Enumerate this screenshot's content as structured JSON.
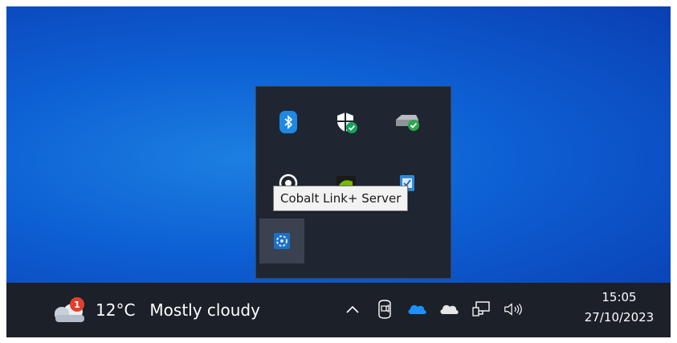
{
  "tray_overflow": {
    "icons": [
      {
        "name": "bluetooth-icon"
      },
      {
        "name": "windows-security-icon"
      },
      {
        "name": "safely-remove-hardware-icon"
      },
      {
        "name": "app-tray-icon"
      },
      {
        "name": "nvidia-icon"
      },
      {
        "name": "security-update-icon"
      },
      {
        "name": "cobalt-link-server-icon"
      }
    ],
    "tooltip": "Cobalt Link+ Server"
  },
  "taskbar": {
    "weather": {
      "badge": "1",
      "temperature": "12°C",
      "condition": "Mostly cloudy"
    },
    "system_icons": [
      {
        "name": "show-hidden-icons-chevron"
      },
      {
        "name": "meet-now-icon"
      },
      {
        "name": "onedrive-icon"
      },
      {
        "name": "onedrive-personal-icon"
      },
      {
        "name": "network-icon"
      },
      {
        "name": "volume-icon"
      }
    ],
    "clock": {
      "time": "15:05",
      "date": "27/10/2023"
    }
  },
  "colors": {
    "desktop": "#0d5fd3",
    "taskbar": "#1b2029",
    "flyout": "#1f2631"
  }
}
